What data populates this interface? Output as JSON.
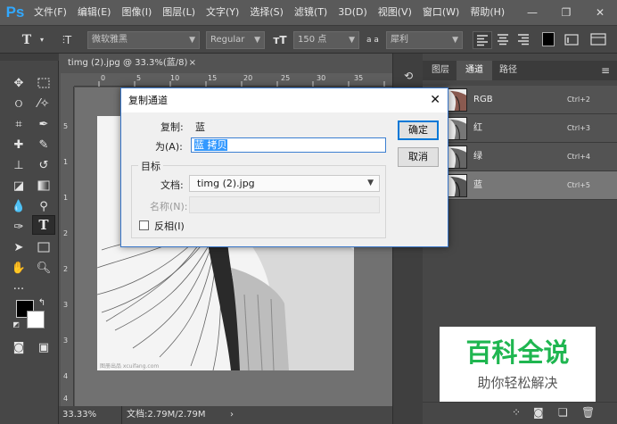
{
  "app": {
    "logo": "Ps"
  },
  "menubar": {
    "items": [
      "文件(F)",
      "编辑(E)",
      "图像(I)",
      "图层(L)",
      "文字(Y)",
      "选择(S)",
      "滤镜(T)",
      "3D(D)",
      "视图(V)",
      "窗口(W)",
      "帮助(H)"
    ],
    "window_buttons": {
      "minimize": "—",
      "restore": "❐",
      "close": "✕"
    }
  },
  "options_bar": {
    "font_family": "微软雅黑",
    "font_style": "Regular",
    "font_size": "150 点",
    "antialias_label": "a a",
    "antialias_value": "犀利",
    "color_swatch": "#000000"
  },
  "document": {
    "tab_title": "timg (2).jpg @ 33.3%(蓝/8)",
    "tab_close": "×",
    "ruler_ticks": [
      "0",
      "5",
      "10",
      "15",
      "20",
      "25",
      "30",
      "35"
    ],
    "ruler_v_ticks": [
      "5",
      "1",
      "1",
      "2",
      "2",
      "3",
      "3",
      "4",
      "4"
    ],
    "canvas_watermark": "图册出品 xcuifang.com"
  },
  "statusbar": {
    "zoom": "33.33%",
    "doc_info": "文档:2.79M/2.79M",
    "arrow": "›"
  },
  "panel": {
    "tabs": [
      "图层",
      "通道",
      "路径"
    ],
    "selected_tab": "通道",
    "menu_icon": "≡",
    "channels": [
      {
        "name": "RGB",
        "shortcut": "Ctrl+2"
      },
      {
        "name": "红",
        "shortcut": "Ctrl+3"
      },
      {
        "name": "绿",
        "shortcut": "Ctrl+4"
      },
      {
        "name": "蓝",
        "shortcut": "Ctrl+5"
      }
    ],
    "selected_channel": "蓝"
  },
  "watermark": {
    "title": "百科全说",
    "subtitle": "助你轻松解决",
    "color": "#1fb650"
  },
  "dialog": {
    "title": "复制通道",
    "close_glyph": "✕",
    "duplicate_label": "复制:",
    "duplicate_value": "蓝",
    "as_label": "为(A):",
    "as_value": "蓝 拷贝",
    "target_group": "目标",
    "document_label": "文档:",
    "document_value": "timg (2).jpg",
    "name_label": "名称(N):",
    "invert_label": "反相(I)",
    "ok_label": "确定",
    "cancel_label": "取消"
  }
}
